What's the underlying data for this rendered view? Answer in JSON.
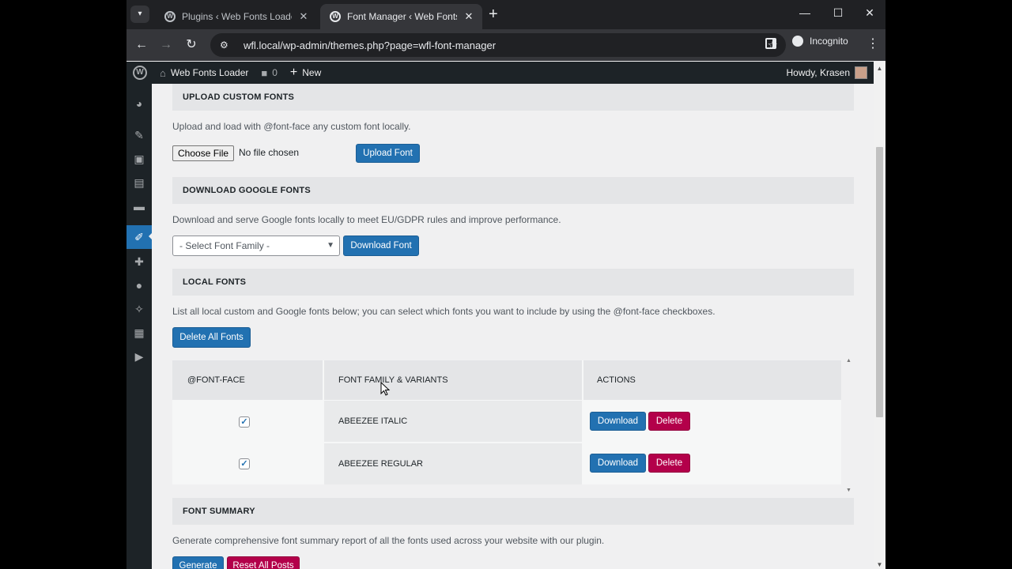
{
  "browser": {
    "tabs": [
      {
        "title": "Plugins ‹ Web Fonts Loader — W",
        "active": false
      },
      {
        "title": "Font Manager ‹ Web Fonts Loa",
        "active": true
      }
    ],
    "url": "wfl.local/wp-admin/themes.php?page=wfl-font-manager",
    "incognito_label": "Incognito"
  },
  "adminbar": {
    "site_name": "Web Fonts Loader",
    "comments_count": "0",
    "new_label": "New",
    "howdy": "Howdy, Krasen"
  },
  "sections": {
    "upload": {
      "title": "UPLOAD CUSTOM FONTS",
      "desc": "Upload and load with @font-face any custom font locally.",
      "choose_file": "Choose File",
      "no_file": "No file chosen",
      "button": "Upload Font"
    },
    "google": {
      "title": "DOWNLOAD GOOGLE FONTS",
      "desc": "Download and serve Google fonts locally to meet EU/GDPR rules and improve performance.",
      "select_placeholder": "- Select Font Family -",
      "button": "Download Font"
    },
    "local": {
      "title": "LOCAL FONTS",
      "desc": "List all local custom and Google fonts below; you can select which fonts you want to include by using the @font-face checkboxes.",
      "delete_all": "Delete All Fonts",
      "columns": [
        "@FONT-FACE",
        "FONT FAMILY & VARIANTS",
        "ACTIONS"
      ],
      "rows": [
        {
          "font": "ABEEZEE ITALIC",
          "checked": true,
          "download": "Download",
          "delete": "Delete"
        },
        {
          "font": "ABEEZEE REGULAR",
          "checked": true,
          "download": "Download",
          "delete": "Delete"
        }
      ]
    },
    "summary": {
      "title": "FONT SUMMARY",
      "desc": "Generate comprehensive font summary report of all the fonts used across your website with our plugin.",
      "generate": "Generate",
      "reset": "Reset All Posts"
    }
  },
  "colors": {
    "primary": "#2271b1",
    "danger": "#b3004a",
    "adminbar": "#1d2327"
  }
}
